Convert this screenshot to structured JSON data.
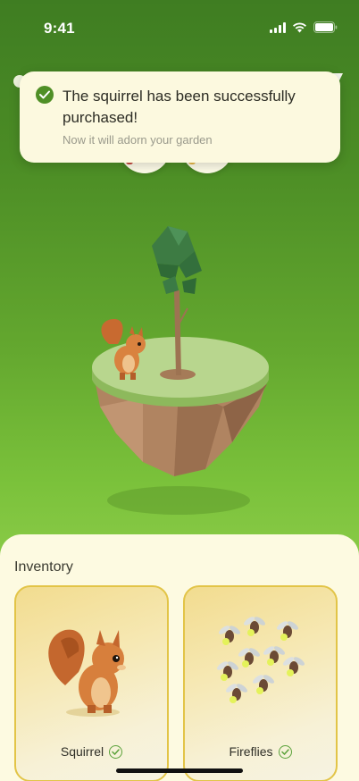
{
  "status_bar": {
    "time": "9:41",
    "icons": [
      "signal-icon",
      "wifi-icon",
      "battery-icon"
    ]
  },
  "toast": {
    "icon": "check-circle-icon",
    "title": "The squirrel has been successfully purchased!",
    "subtitle": "Now it will adorn your garden"
  },
  "scene": {
    "items": [
      "squirrel",
      "tree",
      "floating-island"
    ]
  },
  "inventory": {
    "title": "Inventory",
    "items": [
      {
        "label": "Squirrel",
        "owned": true,
        "icon": "check-icon"
      },
      {
        "label": "Fireflies",
        "owned": true,
        "icon": "check-icon"
      }
    ]
  },
  "colors": {
    "background_top": "#3f7d22",
    "background_bottom": "#87c945",
    "sheet": "#fdfae1",
    "card_border": "#e2c447",
    "accent_green": "#4f8f26"
  }
}
